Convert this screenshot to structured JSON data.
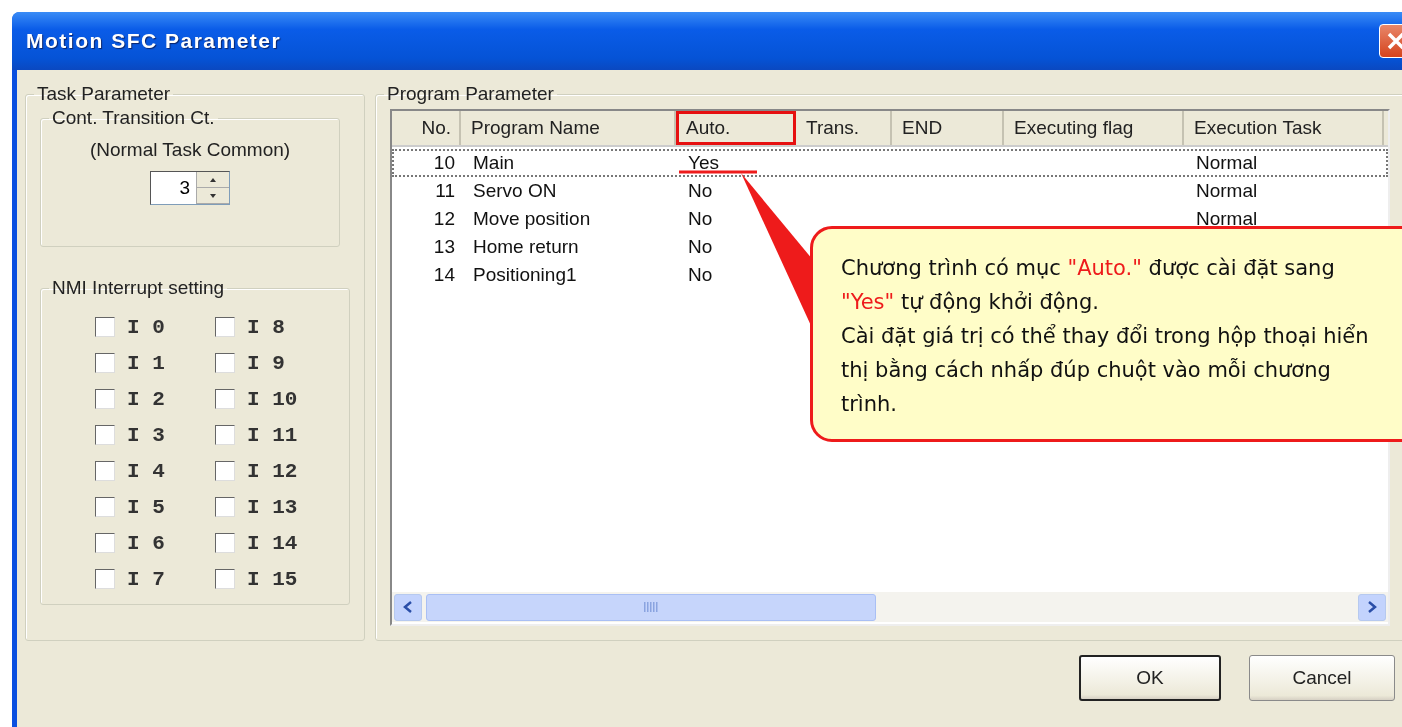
{
  "window": {
    "title": "Motion SFC Parameter"
  },
  "task_parameter": {
    "title": "Task Parameter",
    "cont_transition": {
      "title": "Cont. Transition Ct.",
      "subtitle": "(Normal Task Common)",
      "value": "3"
    },
    "nmi_interrupt": {
      "title": "NMI Interrupt setting",
      "items": [
        {
          "label": "I 0",
          "checked": false
        },
        {
          "label": "I 1",
          "checked": false
        },
        {
          "label": "I 2",
          "checked": false
        },
        {
          "label": "I 3",
          "checked": false
        },
        {
          "label": "I 4",
          "checked": false
        },
        {
          "label": "I 5",
          "checked": false
        },
        {
          "label": "I 6",
          "checked": false
        },
        {
          "label": "I 7",
          "checked": false
        },
        {
          "label": "I 8",
          "checked": false
        },
        {
          "label": "I 9",
          "checked": false
        },
        {
          "label": "I 10",
          "checked": false
        },
        {
          "label": "I 11",
          "checked": false
        },
        {
          "label": "I 12",
          "checked": false
        },
        {
          "label": "I 13",
          "checked": false
        },
        {
          "label": "I 14",
          "checked": false
        },
        {
          "label": "I 15",
          "checked": false
        }
      ]
    }
  },
  "program_parameter": {
    "title": "Program Parameter",
    "columns": [
      {
        "label": "No.",
        "highlighted": false
      },
      {
        "label": "Program Name",
        "highlighted": false
      },
      {
        "label": "Auto.",
        "highlighted": true
      },
      {
        "label": "Trans.",
        "highlighted": false
      },
      {
        "label": "END",
        "highlighted": false
      },
      {
        "label": "Executing flag",
        "highlighted": false
      },
      {
        "label": "Execution Task",
        "highlighted": false
      }
    ],
    "rows": [
      {
        "selected": true,
        "cells": [
          "10",
          "Main",
          "Yes",
          "",
          "",
          "",
          "Normal"
        ]
      },
      {
        "selected": false,
        "cells": [
          "11",
          "Servo ON",
          "No",
          "",
          "",
          "",
          "Normal"
        ]
      },
      {
        "selected": false,
        "cells": [
          "12",
          "Move position",
          "No",
          "",
          "",
          "",
          "Normal"
        ]
      },
      {
        "selected": false,
        "cells": [
          "13",
          "Home return",
          "No",
          "",
          "",
          "",
          ""
        ]
      },
      {
        "selected": false,
        "cells": [
          "14",
          "Positioning1",
          "No",
          "",
          "",
          "",
          ""
        ]
      }
    ]
  },
  "callout": {
    "paragraphs": [
      [
        {
          "text": "Chương trình có mục ",
          "highlighted": false
        },
        {
          "text": "\"Auto.\"",
          "highlighted": true
        },
        {
          "text": " được cài đặt sang ",
          "highlighted": false
        },
        {
          "text": "\"Yes\"",
          "highlighted": true
        },
        {
          "text": " tự động khởi động.",
          "highlighted": false
        }
      ],
      [
        {
          "text": "Cài đặt giá trị có thể thay đổi trong hộp thoại hiển thị bằng cách nhấp đúp chuột vào mỗi chương trình.",
          "highlighted": false
        }
      ]
    ]
  },
  "buttons": [
    {
      "label": "OK",
      "default": true
    },
    {
      "label": "Cancel",
      "default": false
    }
  ]
}
